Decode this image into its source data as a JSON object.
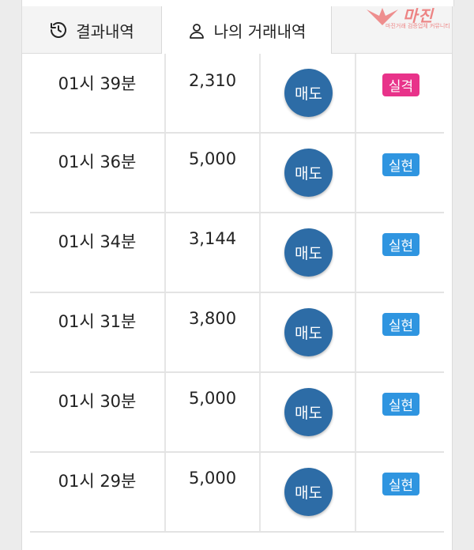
{
  "tabs": [
    {
      "label": "결과내역",
      "icon": "history-icon",
      "active": false
    },
    {
      "label": "나의 거래내역",
      "icon": "user-icon",
      "active": true
    }
  ],
  "watermark": {
    "title": "마진",
    "subtitle": "마진거래 검증업체 커뮤니티"
  },
  "colors": {
    "sell": "#2d6ca6",
    "fail": "#e8338a",
    "success": "#2f95e0"
  },
  "trades": [
    {
      "time": "01시 39분",
      "amount": "2,310",
      "type": "매도",
      "result": "실격",
      "result_color": "#e8338a"
    },
    {
      "time": "01시 36분",
      "amount": "5,000",
      "type": "매도",
      "result": "실현",
      "result_color": "#2f95e0"
    },
    {
      "time": "01시 34분",
      "amount": "3,144",
      "type": "매도",
      "result": "실현",
      "result_color": "#2f95e0"
    },
    {
      "time": "01시 31분",
      "amount": "3,800",
      "type": "매도",
      "result": "실현",
      "result_color": "#2f95e0"
    },
    {
      "time": "01시 30분",
      "amount": "5,000",
      "type": "매도",
      "result": "실현",
      "result_color": "#2f95e0"
    },
    {
      "time": "01시 29분",
      "amount": "5,000",
      "type": "매도",
      "result": "실현",
      "result_color": "#2f95e0"
    }
  ]
}
